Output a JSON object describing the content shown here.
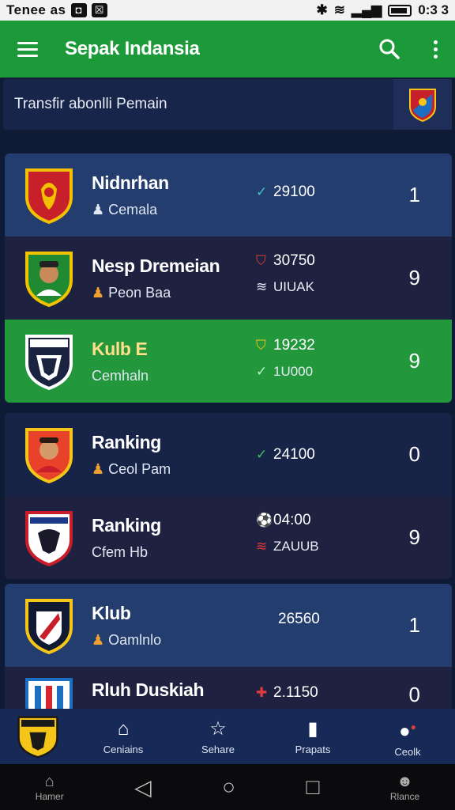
{
  "status_bar": {
    "carrier": "Tenee as",
    "time": "0:3 3"
  },
  "app_bar": {
    "title": "Sepak Indansia"
  },
  "search": {
    "text": "Transfir abonlli Pemain"
  },
  "cards": [
    {
      "rows": [
        {
          "name": "Nidnrhan",
          "sub": "Cemala",
          "stat": "29100",
          "stat_icon": "check-icon",
          "rank": "1",
          "style": "blue",
          "crest_colors": [
            "#c8202a",
            "#f3c000"
          ]
        },
        {
          "name": "Nesp Dremeian",
          "sub": "Peon Baa",
          "stat": "30750",
          "stat_icon": "shield-icon",
          "stat2": "UIUAK",
          "stat2_icon": "book-icon",
          "rank": "9",
          "style": "dark",
          "crest_colors": [
            "#1f8a32",
            "#f0c400"
          ]
        },
        {
          "name": "Kulb",
          "name_extra": "E",
          "sub": "Cemhaln",
          "stat": "19232",
          "stat_icon": "shield-icon",
          "stat2": "1U000",
          "stat2_icon": "check-icon",
          "rank": "9",
          "style": "green",
          "highlight": true,
          "crest_colors": [
            "#1a2340",
            "#ffffff"
          ]
        }
      ]
    },
    {
      "rows": [
        {
          "name": "Ranking",
          "sub": "Ceol Pam",
          "stat": "24100",
          "stat_icon": "check-icon",
          "rank": "0",
          "style": "navy",
          "crest_colors": [
            "#e8422a",
            "#f5c518"
          ]
        },
        {
          "name": "Ranking",
          "sub": "Cfem Hb",
          "stat": "04:00",
          "stat_icon": "ball-icon",
          "stat2": "ZAUUB",
          "stat2_icon": "book-icon",
          "rank": "9",
          "style": "dark",
          "crest_colors": [
            "#ffffff",
            "#c81e2a"
          ]
        }
      ]
    },
    {
      "rows": [
        {
          "name": "Klub",
          "sub": "Oamlnlo",
          "stat": "26560",
          "rank": "1",
          "style": "blue",
          "crest_colors": [
            "#111a33",
            "#f5c518"
          ]
        },
        {
          "name": "Rluh Duskiah",
          "sub": "",
          "stat": "2.1150",
          "stat_icon": "cross-icon",
          "rank": "0",
          "style": "dark",
          "crest_colors": [
            "#1b6ec2",
            "#d8262e"
          ]
        }
      ]
    }
  ],
  "bottom_nav": [
    {
      "label": "",
      "icon": "club-crest-icon"
    },
    {
      "label": "Ceniains",
      "icon": "home-icon"
    },
    {
      "label": "Sehare",
      "icon": "star-icon"
    },
    {
      "label": "Prapats",
      "icon": "trophy-icon"
    },
    {
      "label": "Ceolk",
      "icon": "notification-icon"
    }
  ],
  "system_nav": {
    "left_label": "Hamer",
    "right_label": "Rlance"
  },
  "colors": {
    "primary_green": "#1c9a3a",
    "bg_navy": "#0f1a35",
    "check_green": "#3cc35a",
    "accent_red": "#e03a3a"
  }
}
